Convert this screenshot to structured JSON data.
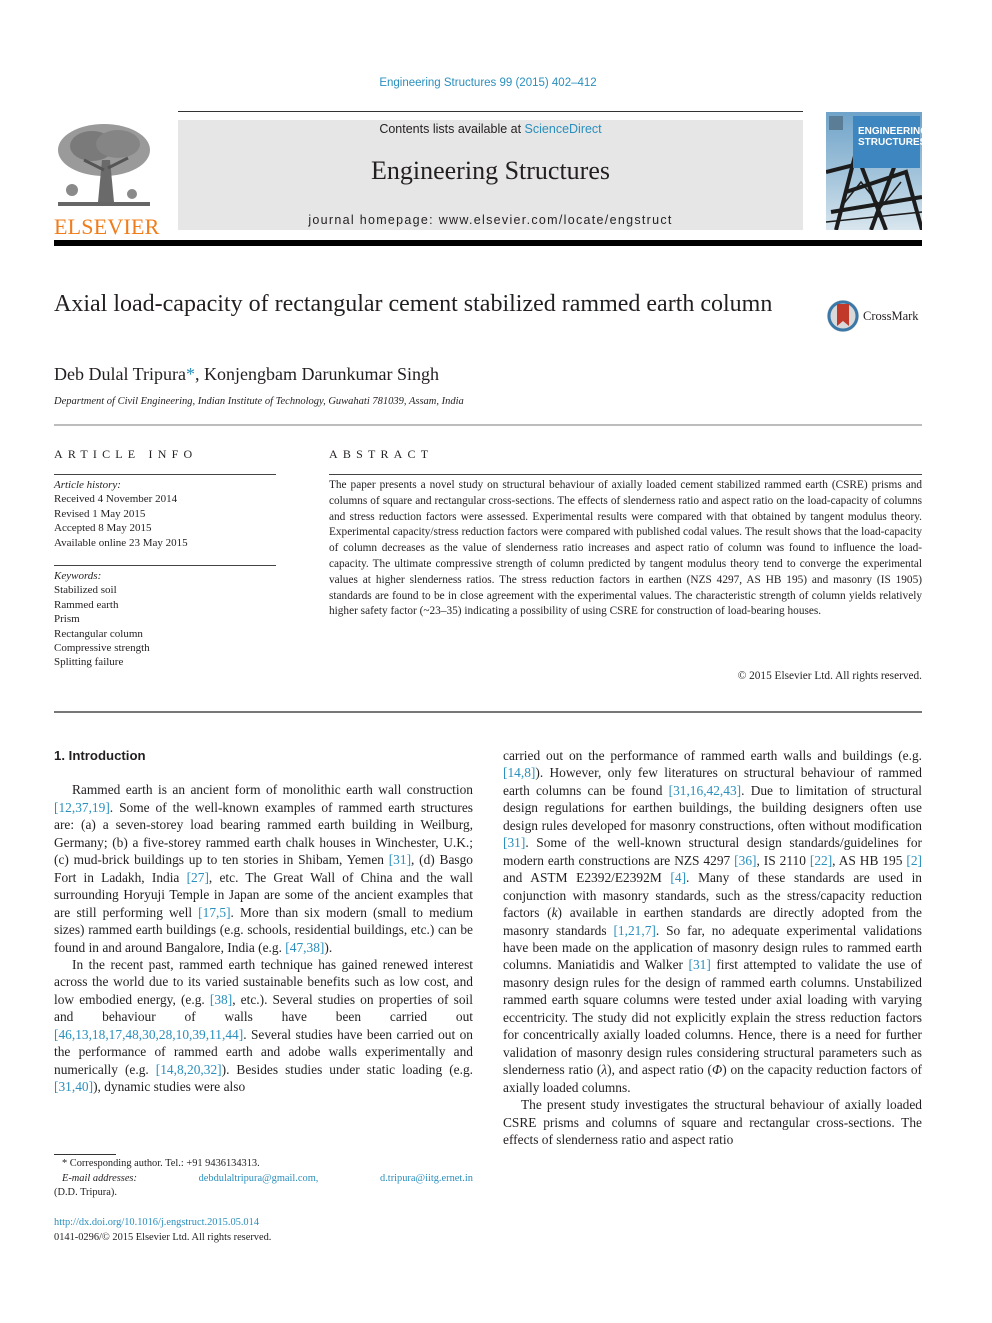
{
  "header": {
    "journal_ref": "Engineering Structures 99 (2015) 402–412",
    "contents_prefix": "Contents lists available at ",
    "contents_link": "ScienceDirect",
    "journal_title": "Engineering Structures",
    "homepage_line": "journal homepage: www.elsevier.com/locate/engstruct",
    "publisher_logo_text": "ELSEVIER",
    "cover_title_line1": "ENGINEERING",
    "cover_title_line2": "STRUCTURES",
    "colors": {
      "link": "#2a8fbd",
      "elsevier_orange": "#f07c1a",
      "masthead_bg": "#e6e6e6"
    }
  },
  "article": {
    "title": "Axial load-capacity of rectangular cement stabilized rammed earth column",
    "crossmark_label": "CrossMark",
    "authors": [
      {
        "name": "Deb Dulal Tripura",
        "mark": "*"
      },
      {
        "name": "Konjengbam Darunkumar Singh",
        "mark": ""
      }
    ],
    "author_separator": ", ",
    "affiliation": "Department of Civil Engineering, Indian Institute of Technology, Guwahati 781039, Assam, India"
  },
  "article_info": {
    "heading": "ARTICLE INFO",
    "history_label": "Article history:",
    "history": [
      "Received 4 November 2014",
      "Revised 1 May 2015",
      "Accepted 8 May 2015",
      "Available online 23 May 2015"
    ],
    "keywords_label": "Keywords:",
    "keywords": [
      "Stabilized soil",
      "Rammed earth",
      "Prism",
      "Rectangular column",
      "Compressive strength",
      "Splitting failure"
    ]
  },
  "abstract": {
    "heading": "ABSTRACT",
    "text": "The paper presents a novel study on structural behaviour of axially loaded cement stabilized rammed earth (CSRE) prisms and columns of square and rectangular cross-sections. The effects of slenderness ratio and aspect ratio on the load-capacity of columns and stress reduction factors were assessed. Experimental results were compared with that obtained by tangent modulus theory. Experimental capacity/stress reduction factors were compared with published codal values. The result shows that the load-capacity of column decreases as the value of slenderness ratio increases and aspect ratio of column was found to influence the load-capacity. The ultimate compressive strength of column predicted by tangent modulus theory tend to converge the experimental values at higher slenderness ratios. The stress reduction factors in earthen (NZS 4297, AS HB 195) and masonry (IS 1905) standards are found to be in close agreement with the experimental values. The characteristic strength of column yields relatively higher safety factor (~23–35) indicating a possibility of using CSRE for construction of load-bearing houses.",
    "copyright": "© 2015 Elsevier Ltd. All rights reserved."
  },
  "body": {
    "section_heading": "1. Introduction",
    "left_paragraphs": [
      [
        {
          "t": "Rammed earth is an ancient form of monolithic earth wall construction "
        },
        {
          "t": "[12,37,19]",
          "ref": true
        },
        {
          "t": ". Some of the well-known examples of rammed earth structures are: (a) a seven-storey load bearing rammed earth building in Weilburg, Germany; (b) a five-storey rammed earth chalk houses in Winchester, U.K.; (c) mud-brick buildings up to ten stories in Shibam, Yemen "
        },
        {
          "t": "[31]",
          "ref": true
        },
        {
          "t": ", (d) Basgo Fort in Ladakh, India "
        },
        {
          "t": "[27]",
          "ref": true
        },
        {
          "t": ", etc. The Great Wall of China and the wall surrounding Horyuji Temple in Japan are some of the ancient examples that are still performing well "
        },
        {
          "t": "[17,5]",
          "ref": true
        },
        {
          "t": ". More than six modern (small to medium sizes) rammed earth buildings (e.g. schools, residential buildings, etc.) can be found in and around Bangalore, India (e.g. "
        },
        {
          "t": "[47,38]",
          "ref": true
        },
        {
          "t": ")."
        }
      ],
      [
        {
          "t": "In the recent past, rammed earth technique has gained renewed interest across the world due to its varied sustainable benefits such as low cost, and low embodied energy, (e.g. "
        },
        {
          "t": "[38]",
          "ref": true
        },
        {
          "t": ", etc.). Several studies on properties of soil and behaviour of walls have been carried out "
        },
        {
          "t": "[46,13,18,17,48,30,28,10,39,11,44]",
          "ref": true
        },
        {
          "t": ". Several studies have been carried out on the performance of rammed earth and adobe walls experimentally and numerically (e.g. "
        },
        {
          "t": "[14,8,20,32]",
          "ref": true
        },
        {
          "t": "). Besides studies under static loading (e.g. "
        },
        {
          "t": "[31,40]",
          "ref": true
        },
        {
          "t": "), dynamic studies were also"
        }
      ]
    ],
    "right_paragraphs": [
      [
        {
          "t": "carried out on the performance of rammed earth walls and buildings (e.g. "
        },
        {
          "t": "[14,8]",
          "ref": true
        },
        {
          "t": "). However, only few literatures on structural behaviour of rammed earth columns can be found "
        },
        {
          "t": "[31,16,42,43]",
          "ref": true
        },
        {
          "t": ". Due to limitation of structural design regulations for earthen buildings, the building designers often use design rules developed for masonry constructions, often without modification "
        },
        {
          "t": "[31]",
          "ref": true
        },
        {
          "t": ". Some of the well-known structural design standards/guidelines for modern earth constructions are NZS 4297 "
        },
        {
          "t": "[36]",
          "ref": true
        },
        {
          "t": ", IS 2110 "
        },
        {
          "t": "[22]",
          "ref": true
        },
        {
          "t": ", AS HB 195 "
        },
        {
          "t": "[2]",
          "ref": true
        },
        {
          "t": " and ASTM E2392/E2392M "
        },
        {
          "t": "[4]",
          "ref": true
        },
        {
          "t": ". Many of these standards are used in conjunction with masonry standards, such as the stress/capacity reduction factors ("
        },
        {
          "t": "k",
          "it": true
        },
        {
          "t": ") available in earthen standards are directly adopted from the masonry standards "
        },
        {
          "t": "[1,21,7]",
          "ref": true
        },
        {
          "t": ". So far, no adequate experimental validations have been made on the application of masonry design rules to rammed earth columns. Maniatidis and Walker "
        },
        {
          "t": "[31]",
          "ref": true
        },
        {
          "t": " first attempted to validate the use of masonry design rules for the design of rammed earth columns. Unstabilized rammed earth square columns were tested under axial loading with varying eccentricity. The study did not explicitly explain the stress reduction factors for concentrically axially loaded columns. Hence, there is a need for further validation of masonry design rules considering structural parameters such as slenderness ratio ("
        },
        {
          "t": "λ",
          "it": true
        },
        {
          "t": "), and aspect ratio ("
        },
        {
          "t": "Φ",
          "it": true
        },
        {
          "t": ") on the capacity reduction factors of axially loaded columns."
        }
      ],
      [
        {
          "t": "The present study investigates the structural behaviour of axially loaded CSRE prisms and columns of square and rectangular cross-sections. The effects of slenderness ratio and aspect ratio"
        }
      ]
    ],
    "right_first_noindent": true
  },
  "footnotes": {
    "corresponding": "* Corresponding author. Tel.: +91 9436134313.",
    "email_label": "E-mail addresses:",
    "emails": [
      "debdulaltripura@gmail.com,",
      "d.tripura@iitg.ernet.in"
    ],
    "email_owner": "(D.D. Tripura).",
    "doi": "http://dx.doi.org/10.1016/j.engstruct.2015.05.014",
    "issn_line": "0141-0296/© 2015 Elsevier Ltd. All rights reserved."
  }
}
